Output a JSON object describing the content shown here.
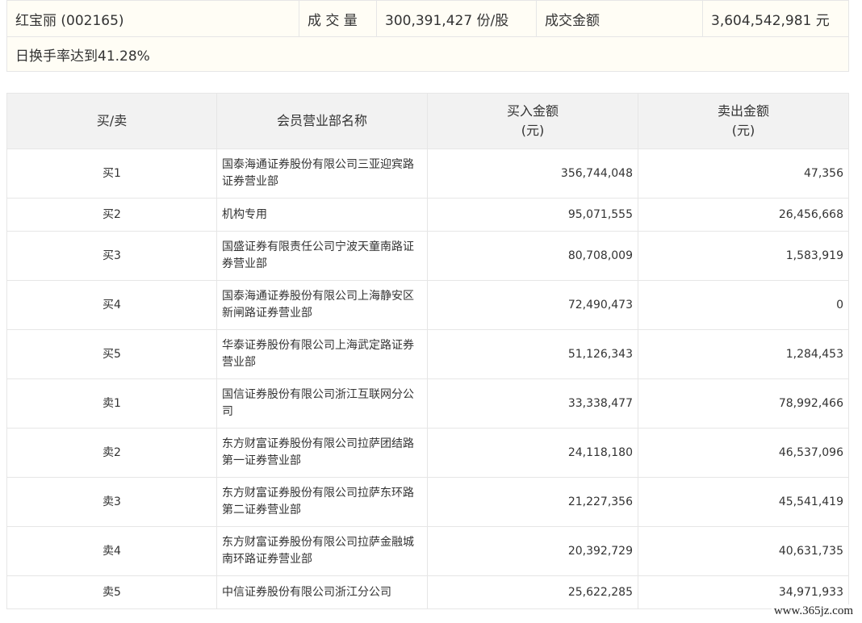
{
  "summary": {
    "stock": "红宝丽 (002165)",
    "volume_label": "成 交 量",
    "volume_value": "300,391,427 份/股",
    "amount_label": "成交金额",
    "amount_value": "3,604,542,981 元",
    "note": "日换手率达到41.28%"
  },
  "table": {
    "headers": {
      "side": "买/卖",
      "member": "会员营业部名称",
      "buy_amount": "买入金额",
      "sell_amount": "卖出金额",
      "unit": "(元)"
    },
    "rows": [
      {
        "side": "买1",
        "name": "国泰海通证券股份有限公司三亚迎宾路证券营业部",
        "buy": "356,744,048",
        "sell": "47,356"
      },
      {
        "side": "买2",
        "name": "机构专用",
        "buy": "95,071,555",
        "sell": "26,456,668"
      },
      {
        "side": "买3",
        "name": "国盛证券有限责任公司宁波天童南路证券营业部",
        "buy": "80,708,009",
        "sell": "1,583,919"
      },
      {
        "side": "买4",
        "name": "国泰海通证券股份有限公司上海静安区新闸路证券营业部",
        "buy": "72,490,473",
        "sell": "0"
      },
      {
        "side": "买5",
        "name": "华泰证券股份有限公司上海武定路证券营业部",
        "buy": "51,126,343",
        "sell": "1,284,453"
      },
      {
        "side": "卖1",
        "name": "国信证券股份有限公司浙江互联网分公司",
        "buy": "33,338,477",
        "sell": "78,992,466"
      },
      {
        "side": "卖2",
        "name": "东方财富证券股份有限公司拉萨团结路第一证券营业部",
        "buy": "24,118,180",
        "sell": "46,537,096"
      },
      {
        "side": "卖3",
        "name": "东方财富证券股份有限公司拉萨东环路第二证券营业部",
        "buy": "21,227,356",
        "sell": "45,541,419"
      },
      {
        "side": "卖4",
        "name": "东方财富证券股份有限公司拉萨金融城南环路证券营业部",
        "buy": "20,392,729",
        "sell": "40,631,735"
      },
      {
        "side": "卖5",
        "name": "中信证券股份有限公司浙江分公司",
        "buy": "25,622,285",
        "sell": "34,971,933"
      }
    ]
  },
  "watermark": "www.365jz.com"
}
